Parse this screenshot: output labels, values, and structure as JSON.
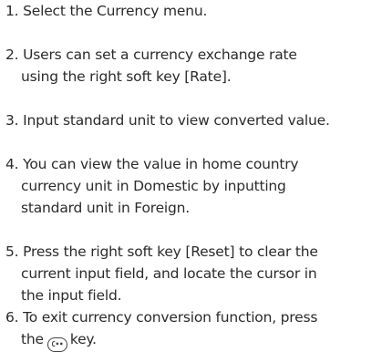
{
  "steps": [
    {
      "number": "1.",
      "lines": [
        "Select the Currency menu."
      ]
    },
    {
      "number": "2.",
      "lines": [
        "Users can set a currency exchange rate",
        "using the right soft key [Rate]."
      ]
    },
    {
      "number": "3.",
      "lines": [
        "Input standard unit to view converted value."
      ]
    },
    {
      "number": "4.",
      "lines": [
        "You can view the value in home country",
        "currency unit in Domestic by inputting",
        "standard unit in Foreign."
      ]
    },
    {
      "number": "5.",
      "lines": [
        "Press the right soft key [Reset] to clear the",
        "current input field, and locate the cursor in",
        "the input field."
      ]
    },
    {
      "number": "6.",
      "lines": [
        "To exit currency conversion function, press"
      ],
      "last_line_before": "the",
      "last_line_after": "key.",
      "key_icon": "clear-key-icon",
      "key_icon_glyph": "C••"
    }
  ]
}
